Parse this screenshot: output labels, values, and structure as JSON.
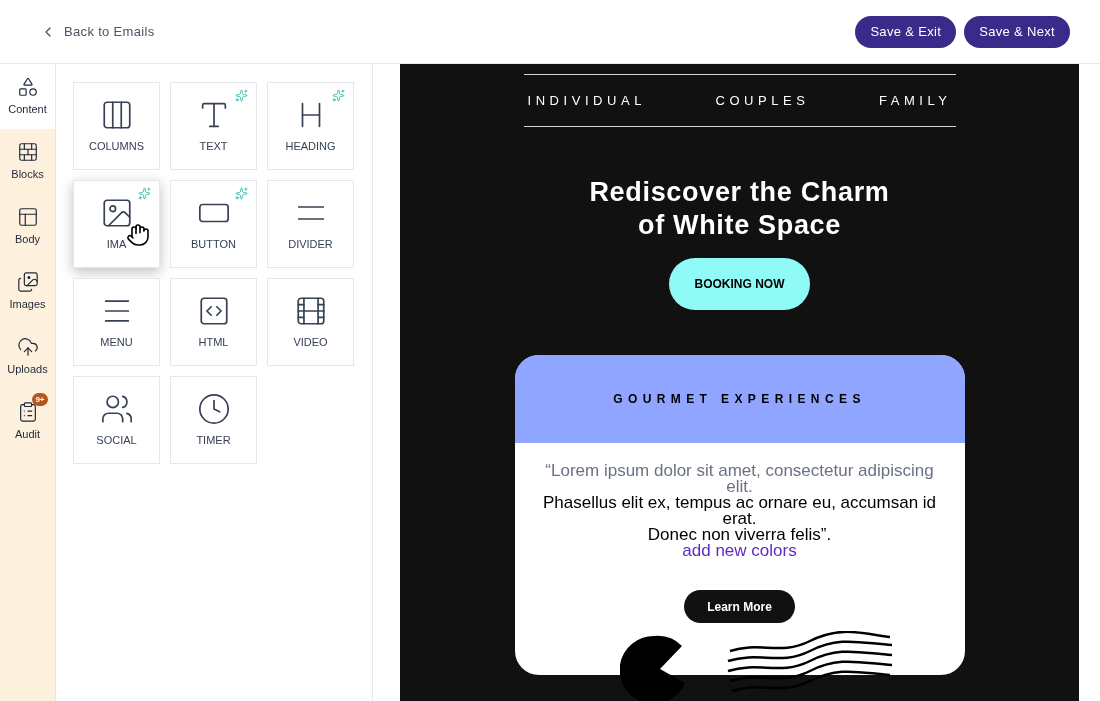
{
  "header": {
    "back_link": "Back to Emails",
    "buttons": [
      "Save & Exit",
      "Save & Next"
    ]
  },
  "sidebar": {
    "items": [
      {
        "kind": "content",
        "label": "Content",
        "selected": true
      },
      {
        "kind": "blocks",
        "label": "Blocks",
        "selected": false
      },
      {
        "kind": "body",
        "label": "Body",
        "selected": false
      },
      {
        "kind": "images",
        "label": "Images",
        "selected": false
      },
      {
        "kind": "uploads",
        "label": "Uploads",
        "selected": false
      },
      {
        "kind": "audit",
        "label": "Audit",
        "selected": false,
        "badge": "9+"
      }
    ]
  },
  "tools": [
    {
      "kind": "columns",
      "label": "COLUMNS",
      "ai": false,
      "hovered": false
    },
    {
      "kind": "text",
      "label": "TEXT",
      "ai": true,
      "hovered": false
    },
    {
      "kind": "heading",
      "label": "HEADING",
      "ai": true,
      "hovered": false
    },
    {
      "kind": "image",
      "label": "IMA",
      "ai": true,
      "hovered": true
    },
    {
      "kind": "button",
      "label": "BUTTON",
      "ai": true,
      "hovered": false
    },
    {
      "kind": "divider",
      "label": "DIVIDER",
      "ai": false,
      "hovered": false
    },
    {
      "kind": "menu",
      "label": "MENU",
      "ai": false,
      "hovered": false
    },
    {
      "kind": "html",
      "label": "HTML",
      "ai": false,
      "hovered": false
    },
    {
      "kind": "video",
      "label": "VIDEO",
      "ai": false,
      "hovered": false
    },
    {
      "kind": "social",
      "label": "SOCIAL",
      "ai": false,
      "hovered": false
    },
    {
      "kind": "timer",
      "label": "TIMER",
      "ai": false,
      "hovered": false
    }
  ],
  "email": {
    "nav": [
      "INDIVIDUAL",
      "COUPLES",
      "FAMILY"
    ],
    "headline": [
      "Rediscover the Charm",
      "of White Space"
    ],
    "cta": "BOOKING NOW",
    "card": {
      "title": "GOURMET EXPERIENCES",
      "quote": [
        {
          "text": "“Lorem ipsum dolor sit amet, consectetur adipiscing elit.",
          "muted": true
        },
        {
          "text": "Phasellus elit ex, tempus ac ornare eu, accumsan id erat.",
          "muted": false
        },
        {
          "text": "Donec non viverra felis”.",
          "muted": false
        }
      ],
      "link": "add new colors",
      "button": "Learn More"
    }
  }
}
